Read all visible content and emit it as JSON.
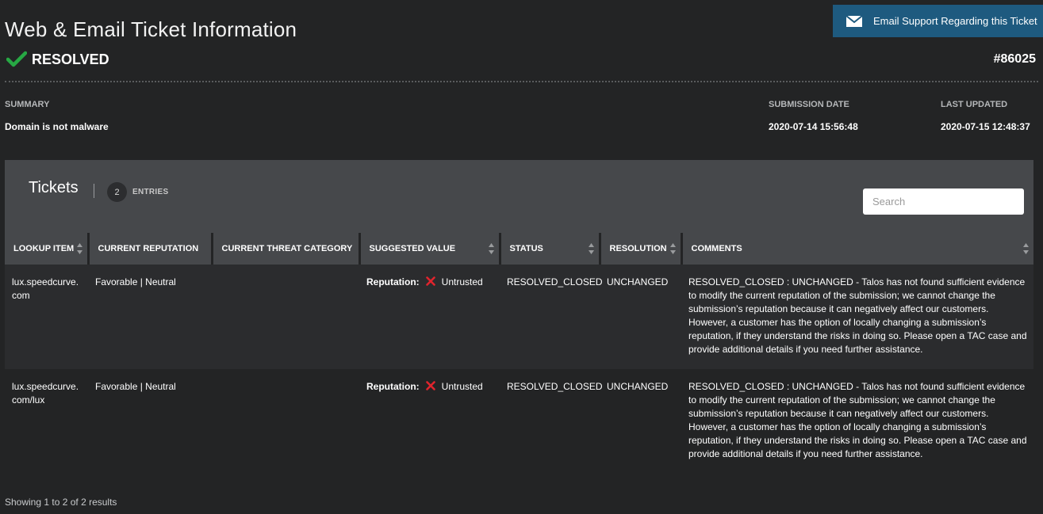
{
  "header": {
    "title": "Web & Email Ticket Information",
    "email_button_label": "Email Support Regarding this Ticket",
    "status": "RESOLVED",
    "ticket_number": "#86025",
    "status_color": "#27a844",
    "button_color": "#1e5a7f"
  },
  "meta": {
    "summary_label": "SUMMARY",
    "summary_value": "Domain is not malware",
    "submission_date_label": "SUBMISSION DATE",
    "submission_date_value": "2020-07-14 15:56:48",
    "last_updated_label": "LAST UPDATED",
    "last_updated_value": "2020-07-15 12:48:37"
  },
  "tickets": {
    "title": "Tickets",
    "count": "2",
    "entries_label": "ENTRIES",
    "search_placeholder": "Search",
    "search_value": "",
    "columns": [
      "LOOKUP ITEM",
      "CURRENT REPUTATION",
      "CURRENT THREAT CATEGORY",
      "SUGGESTED VALUE",
      "STATUS",
      "RESOLUTION",
      "COMMENTS"
    ],
    "rows": [
      {
        "lookup_item": "lux.speedcurve.com",
        "lookup_line1": "lux.speedcurve.",
        "lookup_line2": "com",
        "current_reputation": "Favorable | Neutral",
        "current_threat_category": "",
        "suggested_label": "Reputation:",
        "suggested_value": "Untrusted",
        "status": "RESOLVED_CLOSED",
        "resolution": "UNCHANGED",
        "comments": "RESOLVED_CLOSED : UNCHANGED - Talos has not found sufficient evidence to modify the current reputation of the submission; we cannot change the submission’s reputation because it can negatively affect our customers. However, a customer has the option of locally changing a submission’s reputation, if they understand the risks in doing so. Please open a TAC case and provide additional details if you need further assistance."
      },
      {
        "lookup_item": "lux.speedcurve.com/lux",
        "lookup_line1": "lux.speedcurve.",
        "lookup_line2": "com/lux",
        "current_reputation": "Favorable | Neutral",
        "current_threat_category": "",
        "suggested_label": "Reputation:",
        "suggested_value": "Untrusted",
        "status": "RESOLVED_CLOSED",
        "resolution": "UNCHANGED",
        "comments": "RESOLVED_CLOSED : UNCHANGED - Talos has not found sufficient evidence to modify the current reputation of the submission; we cannot change the submission’s reputation because it can negatively affect our customers. However, a customer has the option of locally changing a submission’s reputation, if they understand the risks in doing so. Please open a TAC case and provide additional details if you need further assistance."
      }
    ],
    "untrusted_icon": "x-icon",
    "untrusted_color": "#e0242d",
    "footer": "Showing 1 to 2 of 2 results"
  }
}
